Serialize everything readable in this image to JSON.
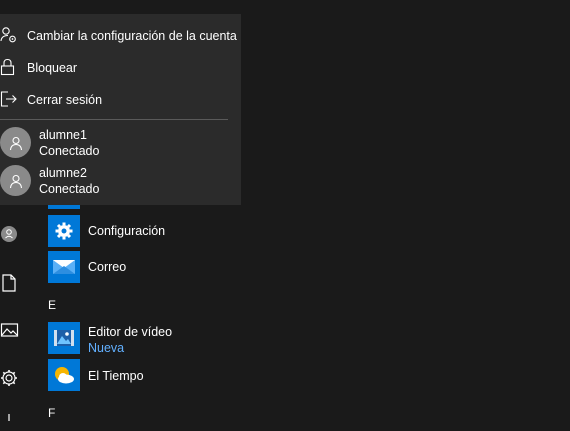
{
  "account_menu": {
    "items": [
      {
        "label": "Cambiar la configuración de la cuenta",
        "icon": "user-settings-icon"
      },
      {
        "label": "Bloquear",
        "icon": "lock-icon"
      },
      {
        "label": "Cerrar sesión",
        "icon": "sign-out-icon"
      }
    ],
    "users": [
      {
        "name": "alumne1",
        "status": "Conectado"
      },
      {
        "name": "alumne2",
        "status": "Conectado"
      }
    ]
  },
  "rail": {
    "icons": [
      "user-avatar-icon",
      "documents-icon",
      "pictures-icon",
      "settings-gear-icon"
    ]
  },
  "app_list": {
    "apps": [
      {
        "name": "Configuración",
        "icon": "gear-icon",
        "tile_color": "#0078d7"
      },
      {
        "name": "Correo",
        "icon": "mail-icon",
        "tile_color": "#0078d7"
      },
      {
        "name": "Editor de vídeo",
        "subtitle": "Nueva",
        "icon": "video-editor-icon",
        "tile_color": "#0078d7"
      },
      {
        "name": "El Tiempo",
        "icon": "weather-icon",
        "tile_color": "#0078d7"
      }
    ],
    "section_letters": [
      "E",
      "F"
    ]
  },
  "colors": {
    "background": "#1a1a1a",
    "menu_background": "#2b2b2b",
    "accent": "#0078d7",
    "subtitle": "#62b0ff"
  }
}
